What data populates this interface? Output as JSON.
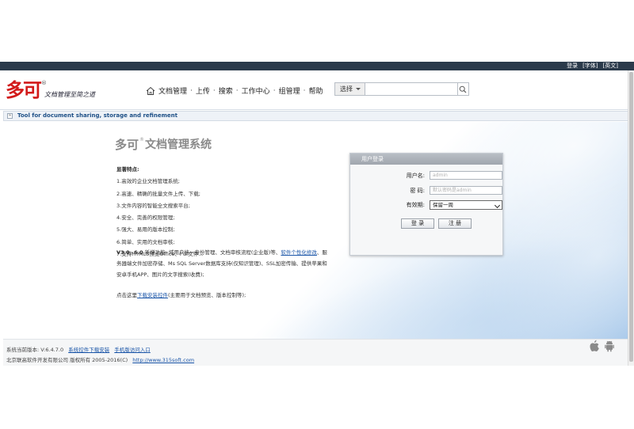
{
  "top_links": [
    "登录",
    "[字体]",
    "[英文]"
  ],
  "logo": {
    "brand": "多可",
    "reg": "®",
    "slogan": "文档管理至简之道"
  },
  "nav": {
    "items": [
      "文档管理",
      "上传",
      "搜索",
      "工作中心",
      "组管理",
      "帮助"
    ],
    "separator": "·"
  },
  "search": {
    "select_label": "选择",
    "value": ""
  },
  "tagline": "Tool for document sharing, storage and refinement",
  "title": {
    "brand": "多可",
    "reg": "®",
    "rest": "文档管理系统"
  },
  "features": {
    "heading": "显著特点:",
    "items": [
      "1.高效的企业文档管理系统;",
      "2.高速、精确的批量文件上传、下载;",
      "3.文件内容的智能全文搜索平台;",
      "4.安全、完善的权限管理;",
      "5.强大、易用的版本控制;",
      "6.简单、实用的文档审核;",
      "7.支持HTML5预览Office、Pdf文件..."
    ]
  },
  "v3": {
    "label": "V3.0~6.0",
    "text1": " 新增功能: 域用户统一身份管理、文档审核流程(企业版)等、",
    "link": "软件个性化修改",
    "text2": "、服务器端文件加密存储、Ms SQL Server数据库支持(仅知识管理)、SSL加密传输、提供苹果和安卓手机APP、图片的文字搜索(收费);"
  },
  "plugin": {
    "prefix": "点击这里",
    "link": "下载安装控件",
    "suffix": "(主要用于文档预览、版本控制等);"
  },
  "login": {
    "header": "用户登录",
    "username_label": "用户名:",
    "username_placeholder": "admin",
    "password_label": "密  码:",
    "password_placeholder": "默认密码是admin",
    "validity_label": "有效期:",
    "validity_value": "保留一周",
    "login_button": "登 录",
    "register_button": "注 册"
  },
  "footer": {
    "version_label": "系统当前版本: V:6.4.7.0",
    "plugin_link": "系统控件下载安装",
    "mobile_link": "手机版访问入口",
    "copyright": "北京联高软件开发有限公司 版权所有 2005-2016(C)",
    "site_link": "http://www.315soft.com"
  },
  "colors": {
    "dark_bar": "#2b3a4b",
    "brand_red": "#d21a1a",
    "link_blue": "#1a55a8",
    "tagline_blue": "#1d4f86"
  }
}
